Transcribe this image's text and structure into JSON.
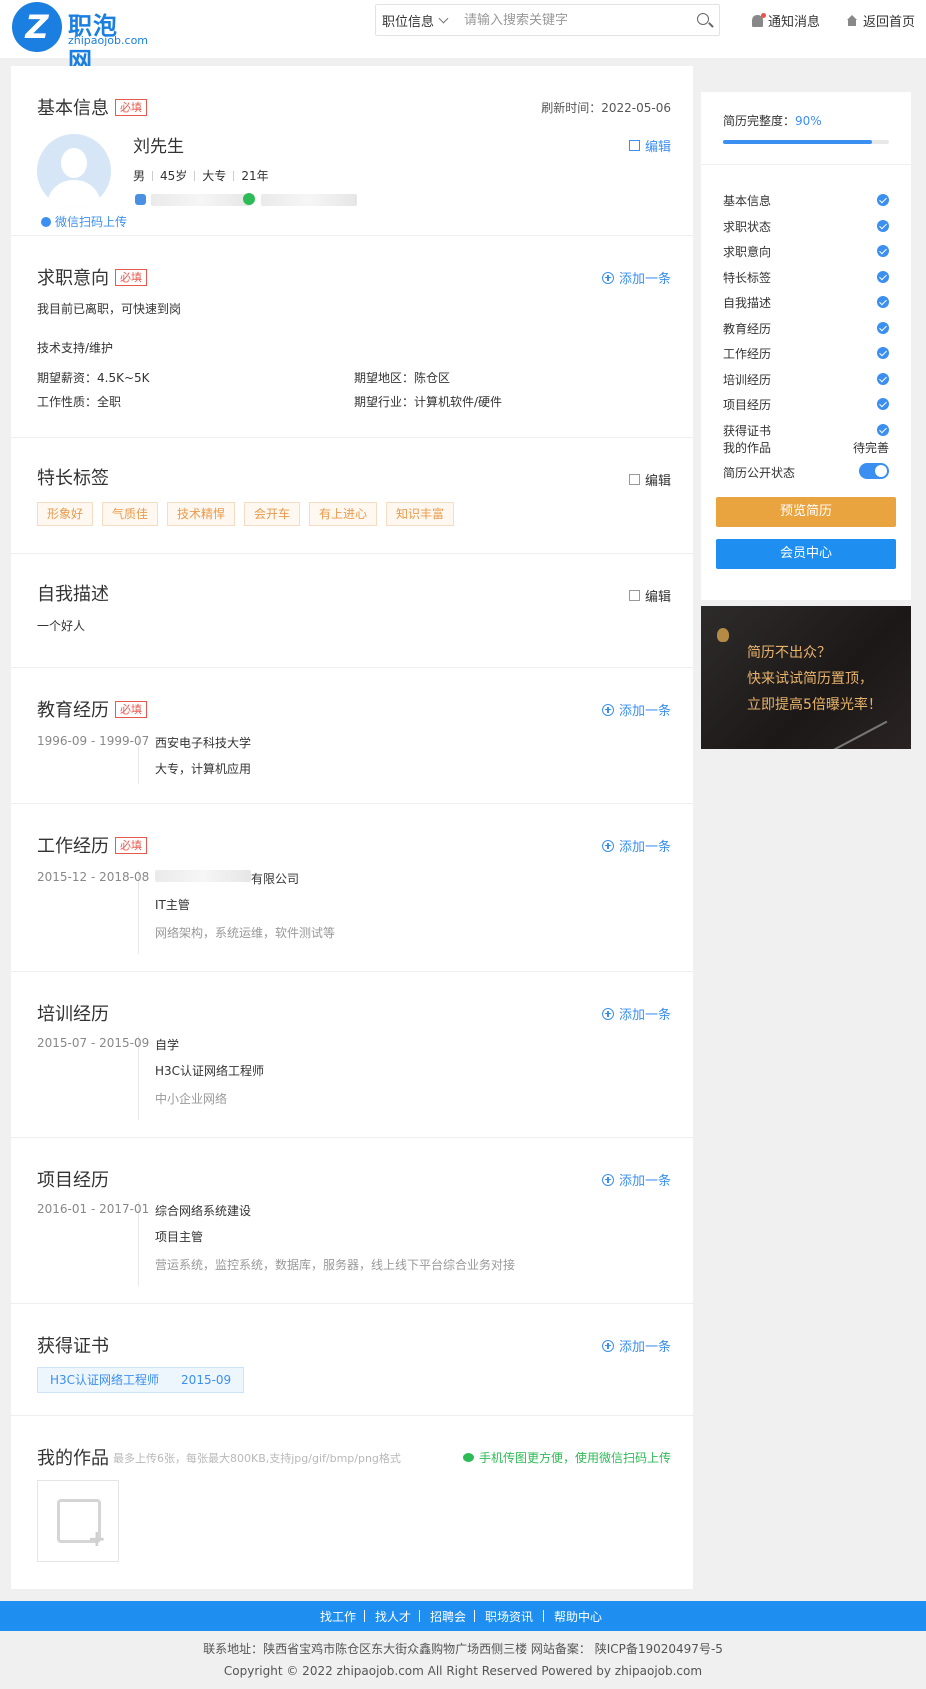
{
  "header": {
    "logo_text": "职泡网",
    "logo_sub": "zhipaojob.com",
    "search_category": "职位信息",
    "search_placeholder": "请输入搜索关键字",
    "notify": "通知消息",
    "home": "返回首页"
  },
  "basic": {
    "title": "基本信息",
    "required": "必填",
    "refresh": "刷新时间：2022-05-06",
    "name": "刘先生",
    "edit": "编辑",
    "gender": "男",
    "age": "45岁",
    "edu": "大专",
    "exp": "21年",
    "upload": "微信扫码上传"
  },
  "intent": {
    "title": "求职意向",
    "required": "必填",
    "add": "添加一条",
    "status": "我目前已离职，可快速到岗",
    "job": "技术支持/维护",
    "salary": "期望薪资：4.5K~5K",
    "area": "期望地区：陈仓区",
    "nature": "工作性质：全职",
    "industry": "期望行业：计算机软件/硬件"
  },
  "skills": {
    "title": "特长标签",
    "edit": "编辑",
    "tags": [
      "形象好",
      "气质佳",
      "技术精悍",
      "会开车",
      "有上进心",
      "知识丰富"
    ]
  },
  "desc": {
    "title": "自我描述",
    "edit": "编辑",
    "text": "一个好人"
  },
  "education": {
    "title": "教育经历",
    "required": "必填",
    "add": "添加一条",
    "period": "1996-09 - 1999-07",
    "school": "西安电子科技大学",
    "major": "大专，计算机应用"
  },
  "work": {
    "title": "工作经历",
    "required": "必填",
    "add": "添加一条",
    "period": "2015-12 - 2018-08",
    "company_suffix": "有限公司",
    "position": "IT主管",
    "content": "网络架构，系统运维，软件测试等"
  },
  "training": {
    "title": "培训经历",
    "add": "添加一条",
    "period": "2015-07 - 2015-09",
    "org": "自学",
    "course": "H3C认证网络工程师",
    "content": "中小企业网络"
  },
  "project": {
    "title": "项目经历",
    "add": "添加一条",
    "period": "2016-01 - 2017-01",
    "name": "综合网络系统建设",
    "role": "项目主管",
    "content": "营运系统，监控系统，数据库，服务器，线上线下平台综合业务对接"
  },
  "cert": {
    "title": "获得证书",
    "add": "添加一条",
    "name": "H3C认证网络工程师",
    "date": "2015-09"
  },
  "works": {
    "title": "我的作品",
    "hint": "最多上传6张，每张最大800KB,支持jpg/gif/bmp/png格式",
    "mobile": "手机传图更方便，使用微信扫码上传"
  },
  "sidebar": {
    "progress_label": "简历完整度：",
    "progress_value": "90%",
    "progress": 0.9,
    "items": [
      {
        "label": "基本信息",
        "done": true
      },
      {
        "label": "求职状态",
        "done": true
      },
      {
        "label": "求职意向",
        "done": true
      },
      {
        "label": "特长标签",
        "done": true
      },
      {
        "label": "自我描述",
        "done": true
      },
      {
        "label": "教育经历",
        "done": true
      },
      {
        "label": "工作经历",
        "done": true
      },
      {
        "label": "培训经历",
        "done": true
      },
      {
        "label": "项目经历",
        "done": true
      },
      {
        "label": "获得证书",
        "done": true
      }
    ],
    "works_label": "我的作品",
    "works_status": "待完善",
    "public_label": "简历公开状态",
    "preview_btn": "预览简历",
    "member_btn": "会员中心"
  },
  "banner": {
    "line1": "简历不出众？",
    "line2": "快来试试简历置顶，",
    "line3": "立即提高5倍曝光率！"
  },
  "footer": {
    "nav": [
      "找工作",
      "找人才",
      "招聘会",
      "职场资讯",
      "帮助中心"
    ],
    "address": "联系地址：陕西省宝鸡市陈仓区东大街众鑫购物广场西侧三楼  网站备案：  陕ICP备19020497号-5",
    "copyright": "Copyright © 2022 zhipaojob.com All Right Reserved Powered by zhipaojob.com"
  },
  "colors": {
    "accent": "#1f8ef1",
    "required": "#e8594d",
    "tag": "#e99a4c",
    "preview": "#e9a33f"
  }
}
